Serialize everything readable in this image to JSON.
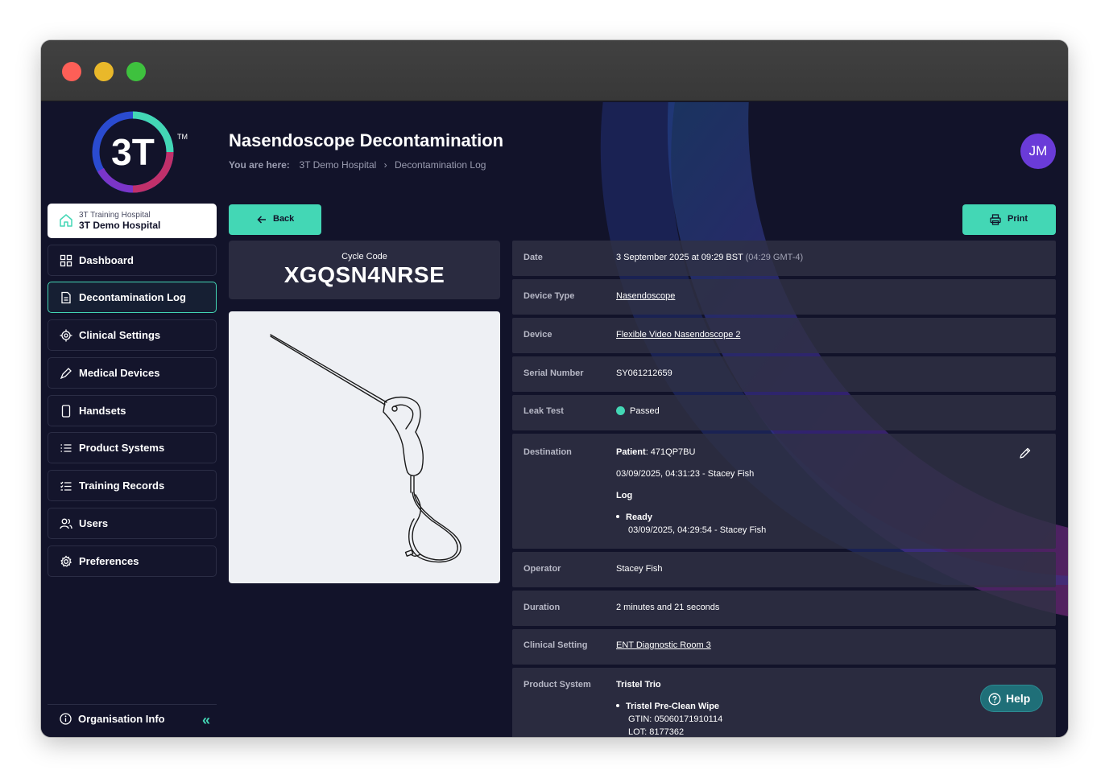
{
  "app": {
    "logo_text": "3T",
    "trademark": "TM"
  },
  "hospital": {
    "sub_label": "3T Training Hospital",
    "name": "3T Demo Hospital"
  },
  "nav": {
    "items": [
      {
        "label": "Dashboard",
        "icon": "grid-icon",
        "active": false
      },
      {
        "label": "Decontamination Log",
        "icon": "document-icon",
        "active": true
      },
      {
        "label": "Clinical Settings",
        "icon": "target-icon",
        "active": false
      },
      {
        "label": "Medical Devices",
        "icon": "pen-icon",
        "active": false
      },
      {
        "label": "Handsets",
        "icon": "phone-icon",
        "active": false
      },
      {
        "label": "Product Systems",
        "icon": "list-icon",
        "active": false
      },
      {
        "label": "Training Records",
        "icon": "checklist-icon",
        "active": false
      },
      {
        "label": "Users",
        "icon": "users-icon",
        "active": false
      },
      {
        "label": "Preferences",
        "icon": "gear-icon",
        "active": false
      }
    ],
    "org_info": "Organisation Info",
    "collapse": "«"
  },
  "header": {
    "title": "Nasendoscope Decontamination",
    "breadcrumb_prefix": "You are here:",
    "breadcrumb": [
      "3T Demo Hospital",
      "Decontamination Log"
    ],
    "avatar_initials": "JM"
  },
  "actions": {
    "back": "Back",
    "print": "Print"
  },
  "cycle": {
    "caption": "Cycle Code",
    "code": "XGQSN4NRSE"
  },
  "details": {
    "date_label": "Date",
    "date_value": "3 September 2025 at 09:29 BST",
    "date_alt": "(04:29 GMT-4)",
    "device_type_label": "Device Type",
    "device_type_value": "Nasendoscope",
    "device_label": "Device",
    "device_value": "Flexible Video Nasendoscope 2",
    "serial_label": "Serial Number",
    "serial_value": "SY061212659",
    "leak_label": "Leak Test",
    "leak_value": "Passed",
    "destination_label": "Destination",
    "patient_label": "Patient",
    "patient_value": ": 471QP7BU",
    "patient_time": "03/09/2025, 04:31:23 - Stacey Fish",
    "log_label": "Log",
    "log_status": "Ready",
    "log_time": "03/09/2025, 04:29:54 - Stacey Fish",
    "operator_label": "Operator",
    "operator_value": "Stacey Fish",
    "duration_label": "Duration",
    "duration_value": "2 minutes and 21 seconds",
    "setting_label": "Clinical Setting",
    "setting_value": "ENT Diagnostic Room 3",
    "product_label": "Product System",
    "product_value": "Tristel Trio",
    "product_item": "Tristel Pre-Clean Wipe",
    "product_gtin": "GTIN: 05060171910114",
    "product_lot": "LOT: 8177362"
  },
  "help": {
    "label": "Help"
  },
  "colors": {
    "accent": "#43d7b5",
    "background": "#12132a",
    "avatar": "#6a3bd8",
    "row": "#303144"
  }
}
